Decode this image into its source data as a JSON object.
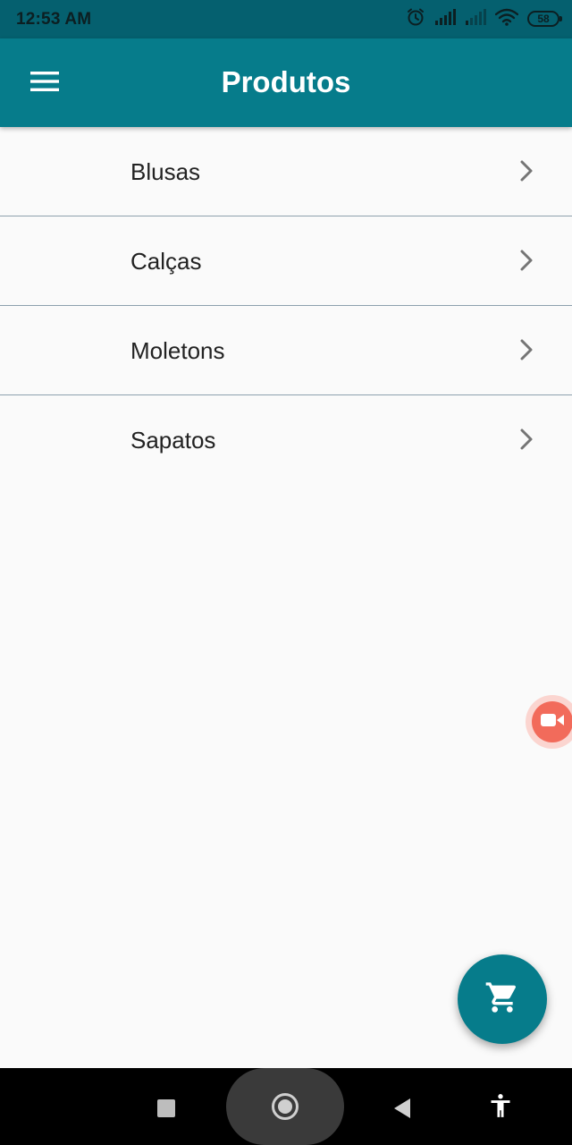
{
  "status_bar": {
    "time": "12:53 AM",
    "battery": "58",
    "icons": [
      "alarm-icon",
      "signal-icon",
      "signal-weak-icon",
      "wifi-icon",
      "battery-icon"
    ]
  },
  "app_bar": {
    "title": "Produtos",
    "menu_icon": "hamburger-menu-icon",
    "color": "#067c8b"
  },
  "products": [
    {
      "label": "Blusas"
    },
    {
      "label": "Calças"
    },
    {
      "label": "Moletons"
    },
    {
      "label": "Sapatos"
    }
  ],
  "floating": {
    "record_icon": "video-camera-icon",
    "fab_icon": "shopping-cart-icon",
    "fab_color": "#067c8b"
  },
  "nav_bar": {
    "icons": [
      "recent-apps-icon",
      "home-icon",
      "back-icon",
      "accessibility-icon"
    ]
  }
}
